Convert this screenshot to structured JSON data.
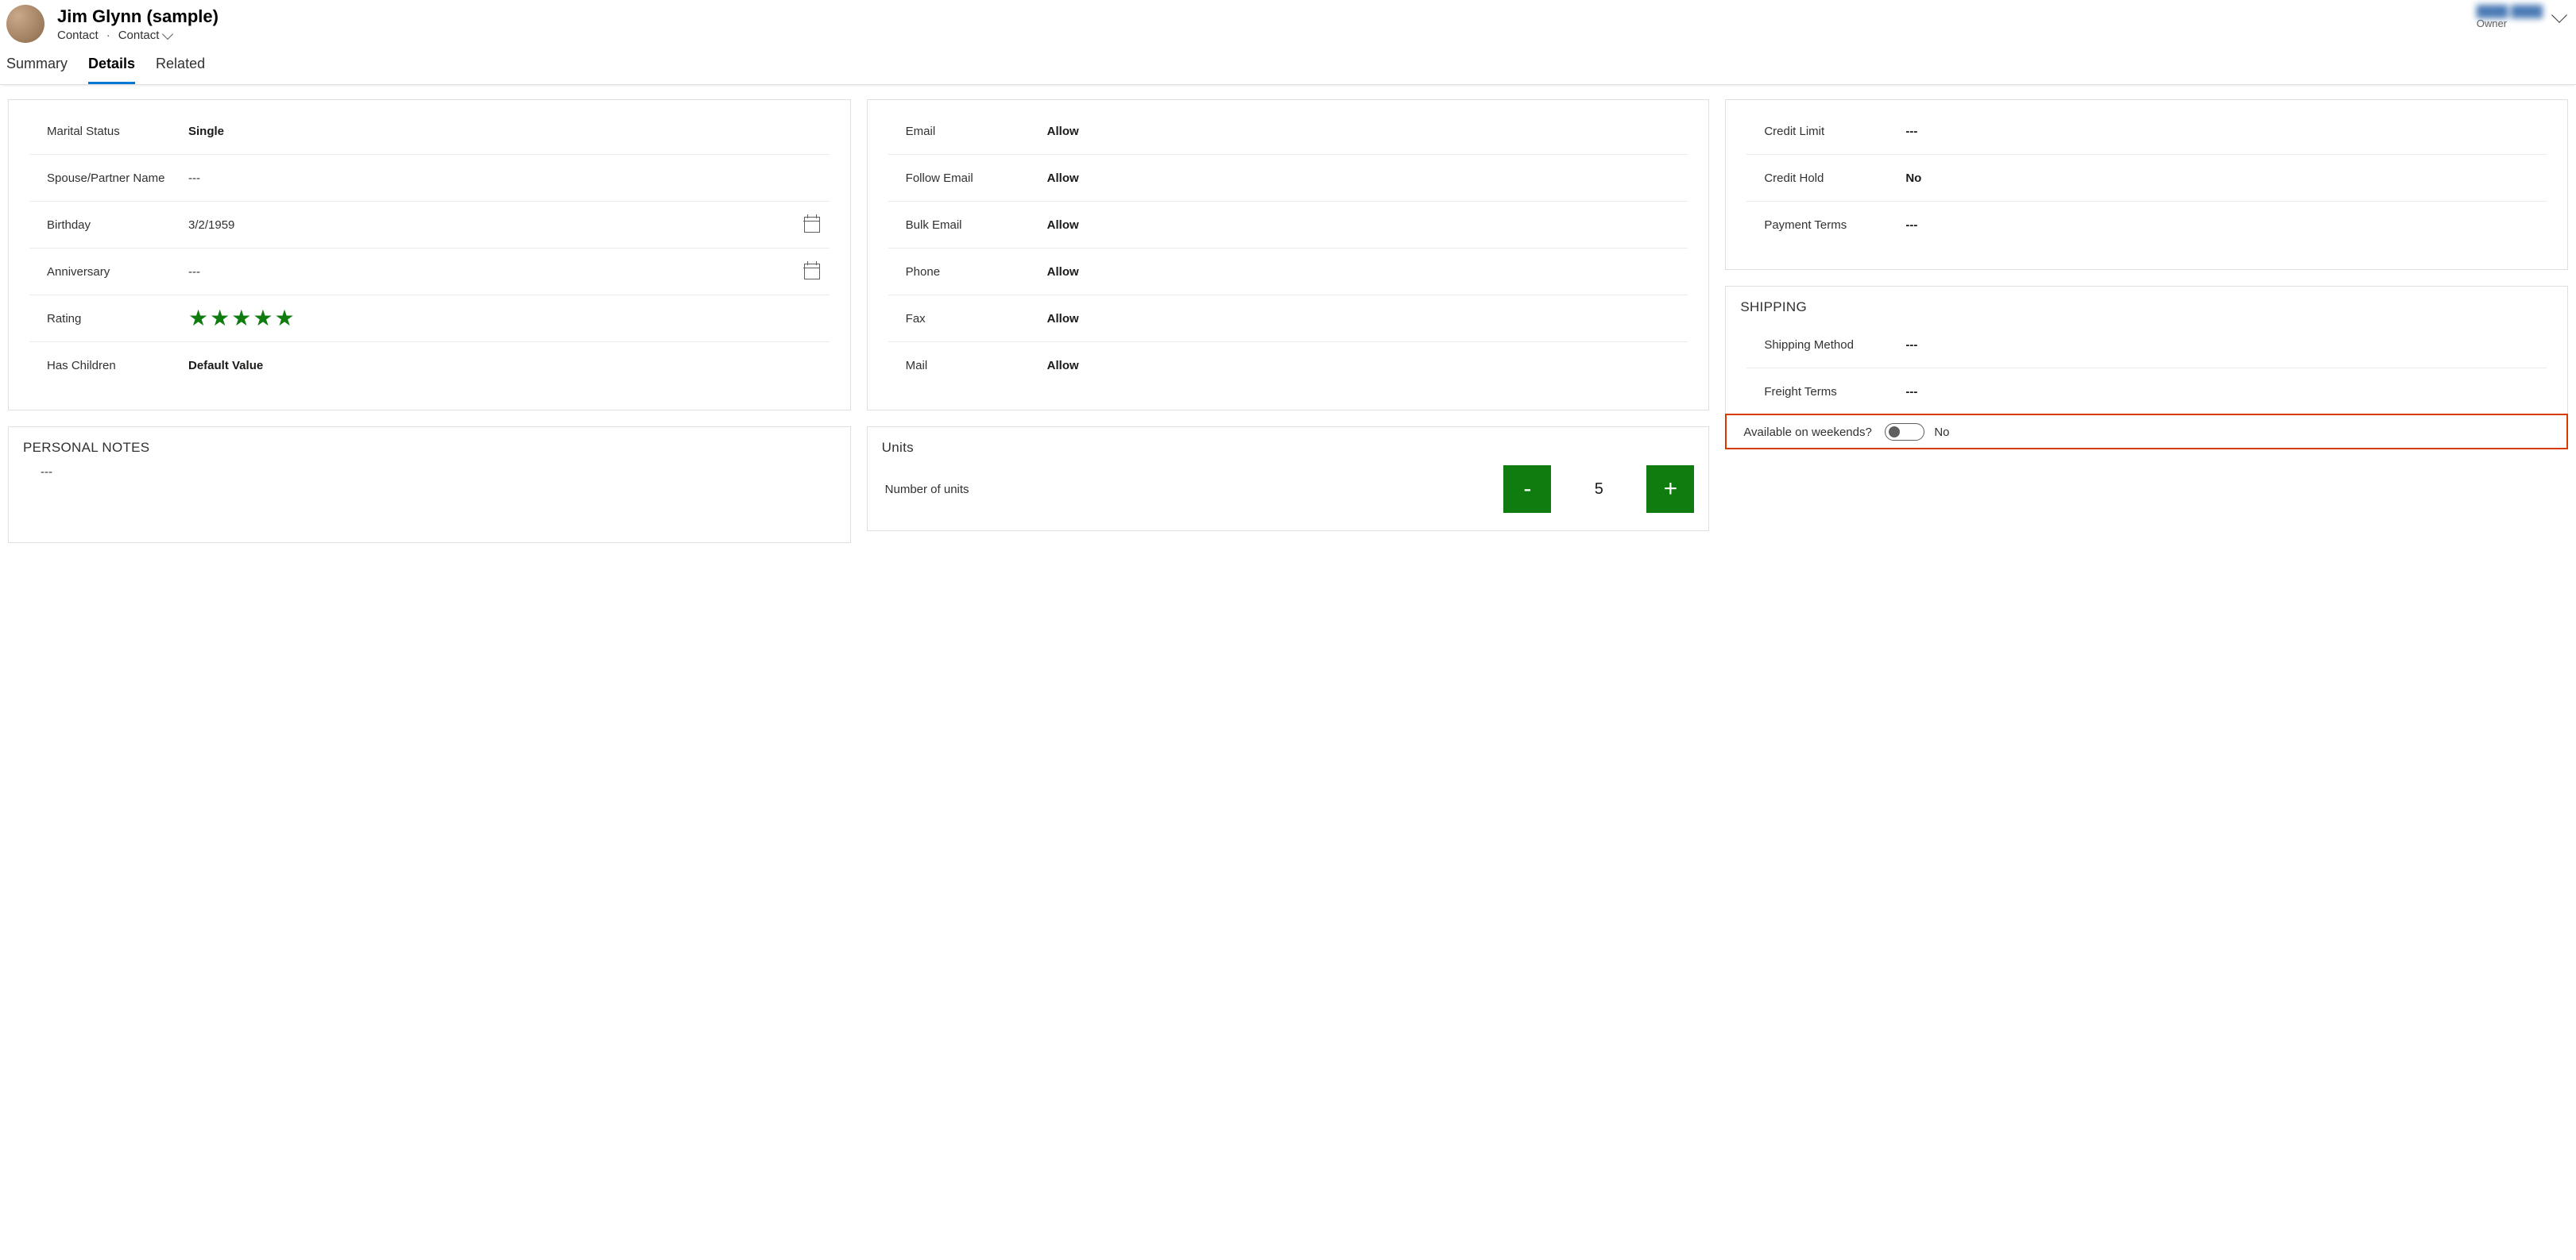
{
  "header": {
    "title": "Jim Glynn (sample)",
    "entity": "Contact",
    "selector": "Contact",
    "owner_name": "████ ████",
    "owner_label": "Owner"
  },
  "tabs": [
    {
      "label": "Summary",
      "active": false
    },
    {
      "label": "Details",
      "active": true
    },
    {
      "label": "Related",
      "active": false
    }
  ],
  "personal": {
    "marital_status_label": "Marital Status",
    "marital_status_value": "Single",
    "spouse_label": "Spouse/Partner Name",
    "spouse_value": "---",
    "birthday_label": "Birthday",
    "birthday_value": "3/2/1959",
    "anniversary_label": "Anniversary",
    "anniversary_value": "---",
    "rating_label": "Rating",
    "rating_value": 5,
    "has_children_label": "Has Children",
    "has_children_value": "Default Value"
  },
  "notes": {
    "title": "PERSONAL NOTES",
    "value": "---"
  },
  "contact_prefs": {
    "email_label": "Email",
    "email_value": "Allow",
    "follow_label": "Follow Email",
    "follow_value": "Allow",
    "bulk_label": "Bulk Email",
    "bulk_value": "Allow",
    "phone_label": "Phone",
    "phone_value": "Allow",
    "fax_label": "Fax",
    "fax_value": "Allow",
    "mail_label": "Mail",
    "mail_value": "Allow"
  },
  "units": {
    "title": "Units",
    "label": "Number of units",
    "value": "5",
    "minus": "-",
    "plus": "+"
  },
  "credit": {
    "credit_limit_label": "Credit Limit",
    "credit_limit_value": "---",
    "credit_hold_label": "Credit Hold",
    "credit_hold_value": "No",
    "payment_terms_label": "Payment Terms",
    "payment_terms_value": "---"
  },
  "shipping": {
    "title": "SHIPPING",
    "method_label": "Shipping Method",
    "method_value": "---",
    "freight_label": "Freight Terms",
    "freight_value": "---",
    "weekends_label": "Available on weekends?",
    "weekends_value": "No"
  }
}
